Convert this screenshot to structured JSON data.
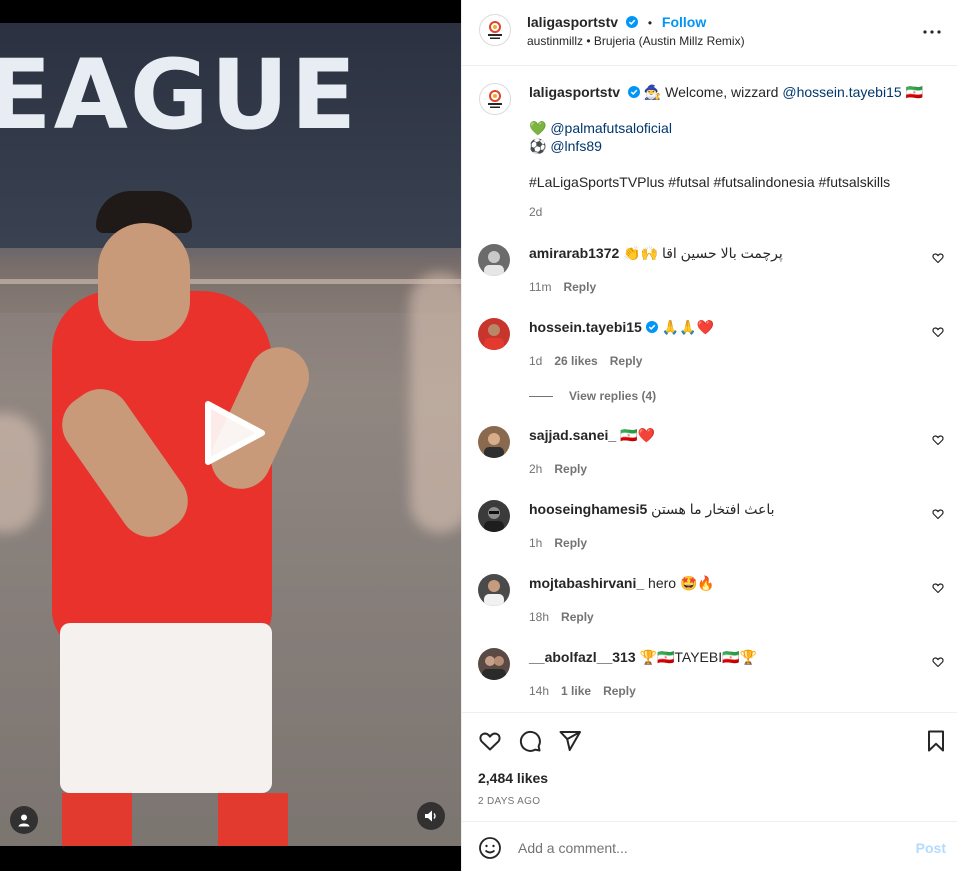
{
  "post": {
    "author": "laligasportstv",
    "follow_label": "Follow",
    "separator": "•",
    "audio": "austinmillz • Brujeria (Austin Millz Remix)",
    "banner_text": "EAGUE"
  },
  "caption": {
    "author": "laligasportstv",
    "line1_prefix": "🧙‍♂️ Welcome, wizzard ",
    "line1_mention": "@hossein.tayebi15",
    "line1_suffix": " 🇮🇷",
    "line2_emoji": "💚",
    "line2_mention": "@palmafutsaloficial",
    "line3_emoji": "⚽",
    "line3_mention": "@lnfs89",
    "hashtags": "#LaLigaSportsTVPlus #futsal #futsalindonesia #futsalskills",
    "time": "2d"
  },
  "comments": [
    {
      "user": "amirarab1372",
      "text": "پرچمت بالا حسین اقا 🙌👏",
      "rtl": true,
      "time": "11m",
      "likes": "",
      "reply": "Reply",
      "avatar_color": "#6b6b6b"
    },
    {
      "user": "hossein.tayebi15",
      "verified": true,
      "text": "🙏🙏❤️",
      "rtl": false,
      "time": "1d",
      "likes": "26 likes",
      "reply": "Reply",
      "avatar_color": "#c8352d"
    },
    {
      "user": "sajjad.sanei_",
      "text": "🇮🇷❤️",
      "rtl": false,
      "time": "2h",
      "likes": "",
      "reply": "Reply",
      "avatar_color": "#8a6a4f"
    },
    {
      "user": "hooseinghamesi5",
      "text": "باعث افتخار ما هستن",
      "rtl": true,
      "time": "1h",
      "likes": "",
      "reply": "Reply",
      "avatar_color": "#3b3b3b"
    },
    {
      "user": "mojtabashirvani_",
      "text": "hero 🤩🔥",
      "rtl": false,
      "time": "18h",
      "likes": "",
      "reply": "Reply",
      "avatar_color": "#4a4a4a"
    },
    {
      "user": "__abolfazl__313",
      "text": "🏆🇮🇷TAYEBI🇮🇷🏆",
      "rtl": false,
      "time": "14h",
      "likes": "1 like",
      "reply": "Reply",
      "avatar_color": "#5a4a45"
    }
  ],
  "view_replies": "View replies (4)",
  "footer": {
    "likes": "2,484 likes",
    "date": "2 DAYS AGO",
    "comment_placeholder": "Add a comment...",
    "post_label": "Post"
  }
}
